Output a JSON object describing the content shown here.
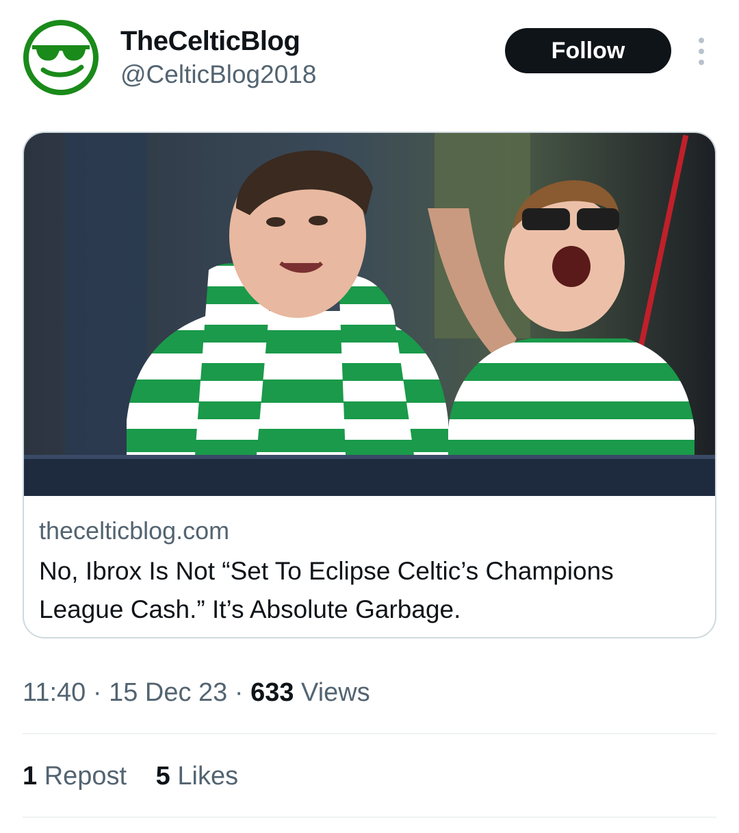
{
  "profile": {
    "name": "TheCelticBlog",
    "handle": "@CelticBlog2018",
    "avatar_icon": "sunglasses-smiley-icon",
    "avatar_color": "#1a8a1a"
  },
  "actions": {
    "follow_label": "Follow",
    "more_icon": "more-vertical-icon"
  },
  "card": {
    "domain": "thecelticblog.com",
    "title": "No, Ibrox Is Not “Set To Eclipse Celtic’s Champions League Cash.” It’s Absolute Garbage."
  },
  "meta": {
    "time": "11:40",
    "sep1": " · ",
    "date": "15 Dec 23",
    "sep2": " · ",
    "views_count": "633",
    "views_label": " Views"
  },
  "stats": {
    "reposts_count": "1",
    "reposts_label": " Repost",
    "likes_count": "5",
    "likes_label": " Likes"
  },
  "colors": {
    "text": "#0f1419",
    "secondary": "#536471",
    "border": "#cfd9de",
    "celtic_green": "#1a9a4a"
  }
}
